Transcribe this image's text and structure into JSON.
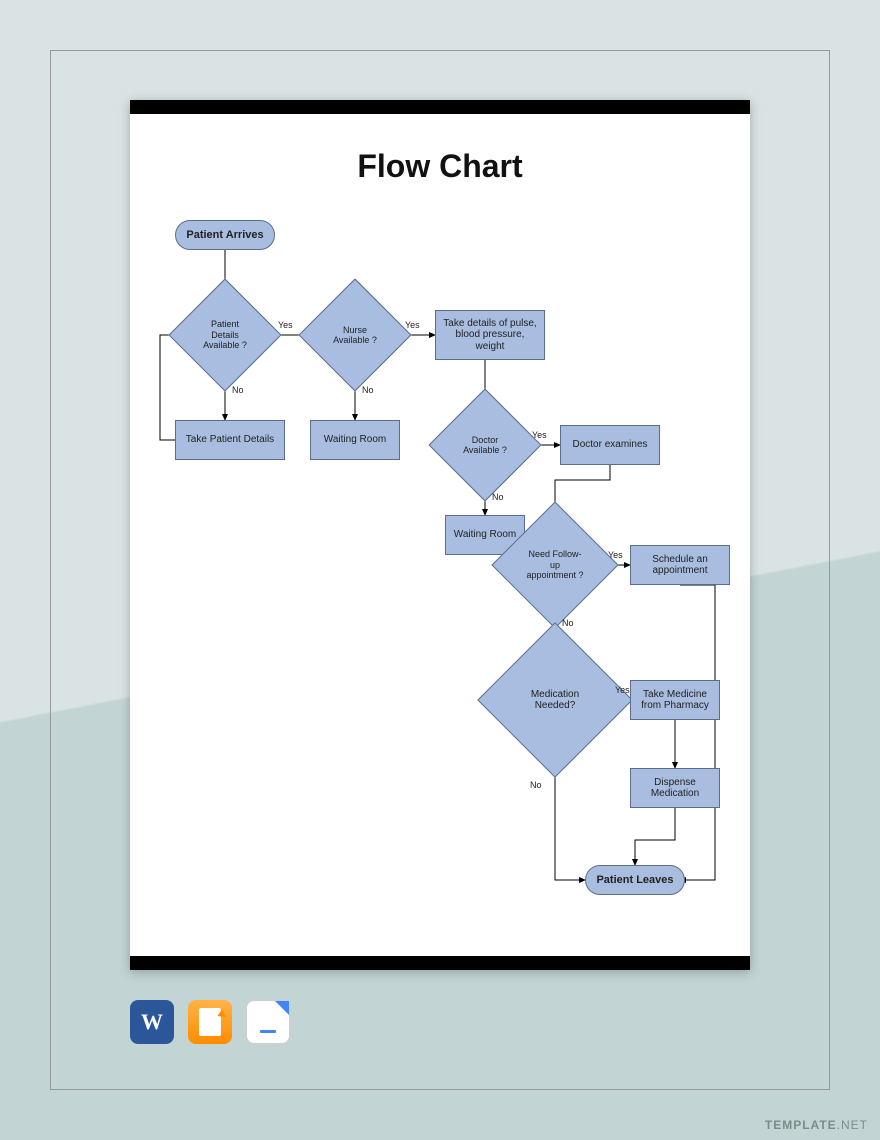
{
  "page": {
    "title": "Flow Chart"
  },
  "flow": {
    "start": "Patient Arrives",
    "end": "Patient Leaves",
    "d_patient_details": "Patient Details Available ?",
    "p_take_details": "Take Patient Details",
    "d_nurse": "Nurse Available ?",
    "p_waiting1": "Waiting Room",
    "p_vitals": "Take details of pulse, blood pressure, weight",
    "d_doctor": "Doctor Available ?",
    "p_waiting2": "Waiting Room",
    "p_examine": "Doctor examines",
    "d_followup": "Need Follow-up appointment ?",
    "p_schedule": "Schedule an appointment",
    "d_medication": "Medication Needed?",
    "p_take_medicine": "Take Medicine from Pharmacy",
    "p_dispense": "Dispense Medication"
  },
  "labels": {
    "yes": "Yes",
    "no": "No"
  },
  "apps": {
    "word": "W",
    "pages": "pages-icon",
    "docs": "docs-icon"
  },
  "watermark": {
    "brand": "TEMPLATE",
    "suffix": ".NET"
  }
}
